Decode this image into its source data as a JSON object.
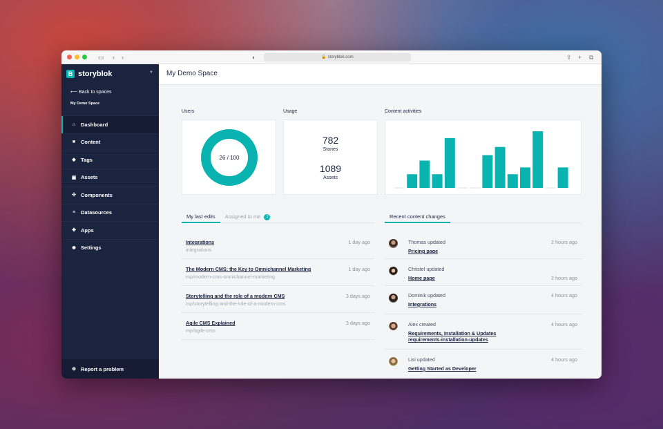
{
  "browser": {
    "url": "storyblok.com"
  },
  "sidebar": {
    "logo_text": "storyblok",
    "back_label": "Back to spaces",
    "space_name": "My Demo Space",
    "items": [
      {
        "label": "Dashboard",
        "icon": "home-icon"
      },
      {
        "label": "Content",
        "icon": "folder-icon"
      },
      {
        "label": "Tags",
        "icon": "tag-icon"
      },
      {
        "label": "Assets",
        "icon": "image-icon"
      },
      {
        "label": "Components",
        "icon": "components-icon"
      },
      {
        "label": "Datasources",
        "icon": "database-icon"
      },
      {
        "label": "Apps",
        "icon": "apps-icon"
      },
      {
        "label": "Settings",
        "icon": "gear-icon"
      }
    ],
    "report_label": "Report a problem"
  },
  "header": {
    "title": "My Demo Space"
  },
  "users": {
    "label": "Users",
    "count": "26",
    "total": "/ 100",
    "ratio": 0.26
  },
  "usage": {
    "label": "Usage",
    "stories_value": "782",
    "stories_label": "Stories",
    "assets_value": "1089",
    "assets_label": "Assets"
  },
  "activities": {
    "label": "Content activities"
  },
  "chart_data": {
    "type": "bar",
    "title": "Content activities",
    "values": [
      0,
      2,
      4,
      2,
      7.3,
      0,
      0,
      4.8,
      6,
      2,
      3,
      8.3,
      0,
      3
    ]
  },
  "edits": {
    "tab_active": "My last edits",
    "tab_inactive": "Assigned to me",
    "badge": "3",
    "rows": [
      {
        "title": "Integrations",
        "slug": "integrations",
        "time": "1 day ago"
      },
      {
        "title": "The Modern CMS: the Key to Omnichannel Marketing",
        "slug": "mp/modern-cms-omnichannel-marketing",
        "time": "1 day ago"
      },
      {
        "title": "Storytelling and the role of a modern CMS",
        "slug": "mp/storytelling-and-the-role-of-a-modern-cms",
        "time": "3 days ago"
      },
      {
        "title": "Agile CMS Explained",
        "slug": "mp/agile-cms",
        "time": "3 days ago"
      }
    ]
  },
  "changes": {
    "tab": "Recent content changes",
    "rows": [
      {
        "action": "Thomas updated",
        "link": "Pricing page",
        "link2": "",
        "time": "2 hours ago"
      },
      {
        "action": "Christel updated",
        "link": "Home page",
        "link2": "",
        "time": "2 hours ago"
      },
      {
        "action": "Dominik updated",
        "link": "Integrations",
        "link2": "",
        "time": "4 hours ago"
      },
      {
        "action": "Alex created",
        "link": "Requirements, Installation & Updates",
        "link2": "requirements-installation-updates",
        "time": "4 hours ago"
      },
      {
        "action": "Lisi updated",
        "link": "Getting Started as Developer",
        "link2": "",
        "time": "4 hours ago"
      }
    ]
  },
  "colors": {
    "accent": "#09b3af",
    "sidebar": "#1b243f"
  }
}
